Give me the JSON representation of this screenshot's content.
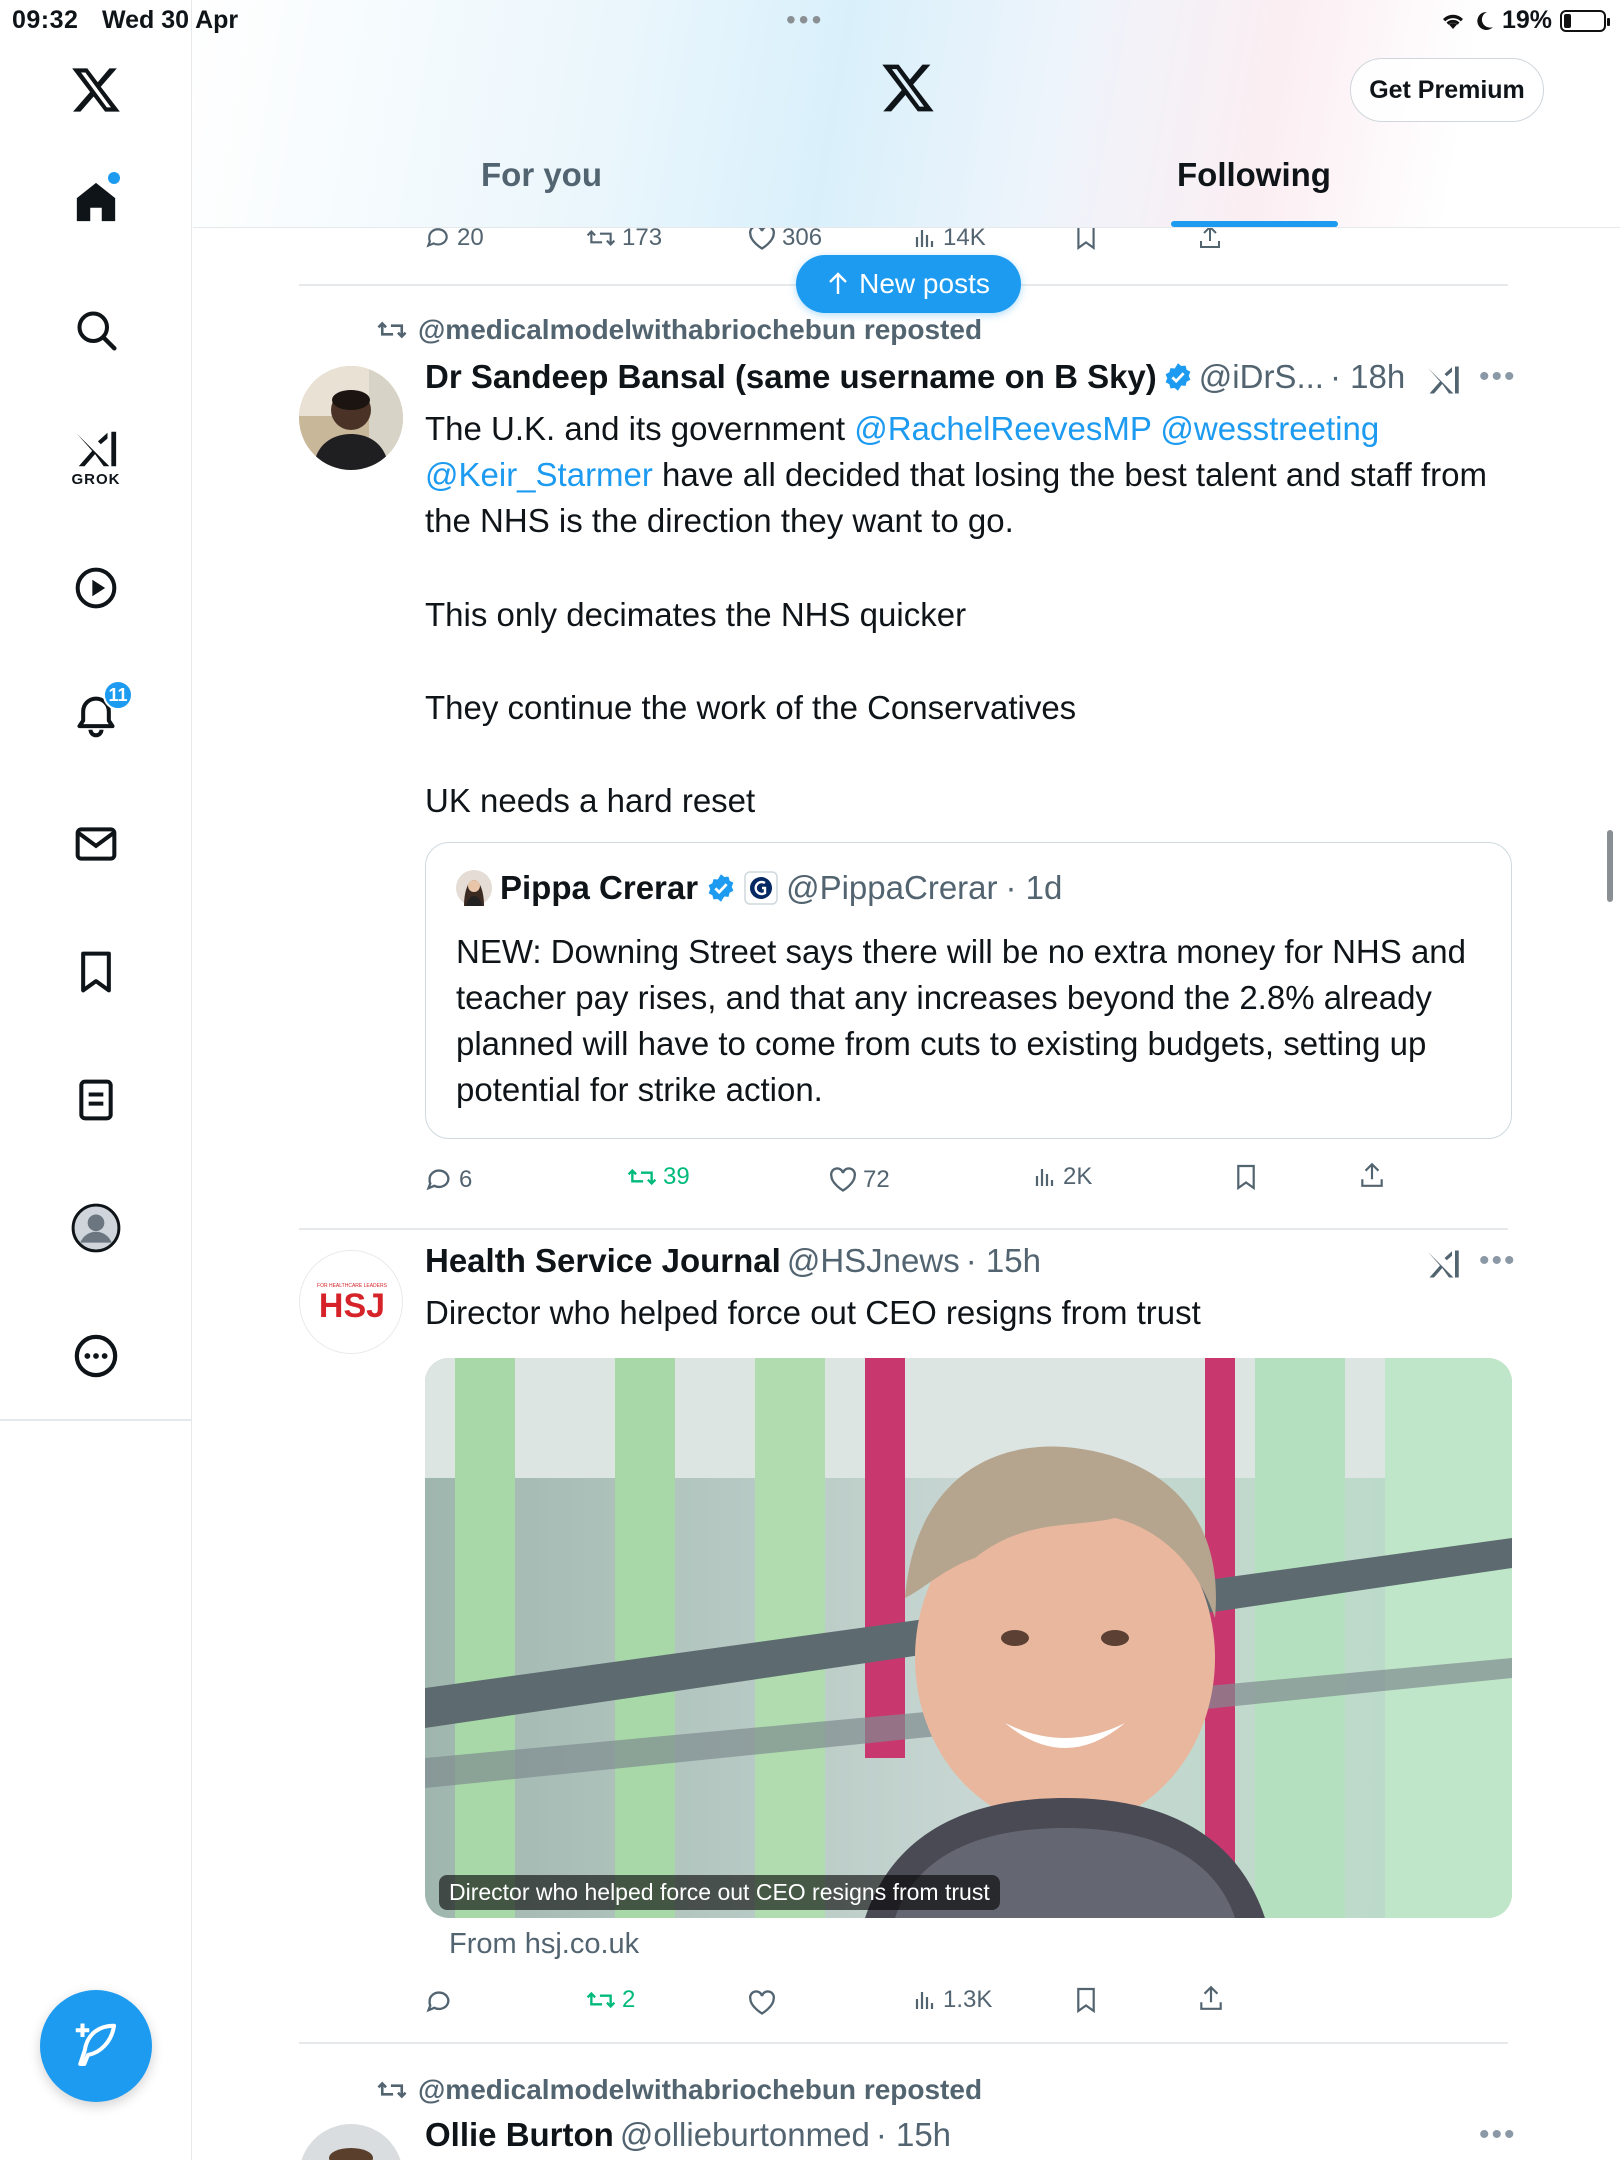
{
  "status_bar": {
    "time": "09:32",
    "date": "Wed 30 Apr",
    "battery": "19%",
    "battery_level": 0.19
  },
  "header": {
    "premium_label": "Get Premium",
    "tabs": [
      "For you",
      "Following"
    ],
    "active_tab": "Following"
  },
  "sidebar": {
    "items": [
      {
        "name": "home-icon"
      },
      {
        "name": "search-icon"
      },
      {
        "name": "grok-icon",
        "label": "GROK"
      },
      {
        "name": "video-icon"
      },
      {
        "name": "notifications-icon",
        "badge": "11"
      },
      {
        "name": "messages-icon"
      },
      {
        "name": "bookmarks-icon"
      },
      {
        "name": "lists-icon"
      },
      {
        "name": "profile-icon"
      },
      {
        "name": "more-icon"
      }
    ]
  },
  "new_posts_label": "New posts",
  "prev_actions": {
    "replies": "20",
    "reposts": "173",
    "likes": "306",
    "views": "14K"
  },
  "post1": {
    "reposted_by": "@medicalmodelwithabriochebun reposted",
    "name": "Dr Sandeep Bansal (same username on B Sky)",
    "handle": "@iDrS...",
    "time": "· 18h",
    "text_line1": "The U.K. and its government ",
    "mention1": "@RachelReevesMP",
    "mention2": "@wesstreeting",
    "mention3": "@Keir_Starmer",
    "text_line2": " have all decided that losing the best talent and staff from the NHS is the direction they want to go.",
    "para2": "This only decimates the NHS quicker",
    "para3": "They continue the work of the Conservatives",
    "para4": "UK needs a hard reset",
    "quote": {
      "name": "Pippa Crerar",
      "handle": "@PippaCrerar",
      "time": "· 1d",
      "text": "NEW: Downing Street says there will be no extra money for NHS and teacher pay rises, and that any increases beyond the 2.8% already planned will have to come from cuts to existing budgets, setting up potential for strike action."
    },
    "actions": {
      "replies": "6",
      "reposts": "39",
      "likes": "72",
      "views": "2K"
    }
  },
  "post2": {
    "avatar_text": "HSJ",
    "avatar_tagline": "FOR HEALTHCARE LEADERS",
    "name": "Health Service Journal",
    "handle": "@HSJnews",
    "time": "· 15h",
    "text": "Director who helped force out CEO resigns from trust",
    "media_caption": "Director who helped force out CEO resigns from trust",
    "source": "From hsj.co.uk",
    "actions": {
      "reposts": "2",
      "views": "1.3K"
    }
  },
  "post3": {
    "reposted_by": "@medicalmodelwithabriochebun reposted",
    "name": "Ollie Burton",
    "handle": "@ollieburtonmed",
    "time": "· 15h"
  },
  "colors": {
    "accent": "#1d9bf0",
    "repost_green": "#00ba7c",
    "muted": "#536471"
  }
}
